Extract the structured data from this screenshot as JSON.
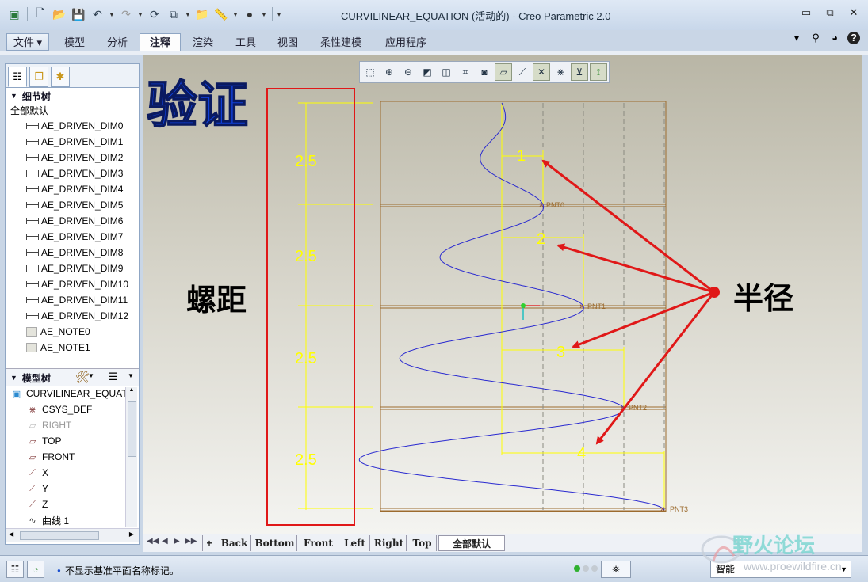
{
  "window": {
    "title": "CURVILINEAR_EQUATION (活动的) - Creo Parametric 2.0",
    "controls": {
      "minimize": "▭",
      "restore": "⧉",
      "close": "✕"
    }
  },
  "ribbon": {
    "tabs": [
      {
        "label": "文件 ▾"
      },
      {
        "label": "模型"
      },
      {
        "label": "分析"
      },
      {
        "label": "注释"
      },
      {
        "label": "渲染"
      },
      {
        "label": "工具"
      },
      {
        "label": "视图"
      },
      {
        "label": "柔性建模"
      },
      {
        "label": "应用程序"
      }
    ],
    "active_tab": "注释",
    "right_icons": [
      "▾",
      "⚲",
      "◕",
      "?"
    ]
  },
  "left_panel": {
    "detail_tree": {
      "title": "细节树",
      "filter": "全部默认",
      "items": [
        "AE_DRIVEN_DIM0",
        "AE_DRIVEN_DIM1",
        "AE_DRIVEN_DIM2",
        "AE_DRIVEN_DIM3",
        "AE_DRIVEN_DIM4",
        "AE_DRIVEN_DIM5",
        "AE_DRIVEN_DIM6",
        "AE_DRIVEN_DIM7",
        "AE_DRIVEN_DIM8",
        "AE_DRIVEN_DIM9",
        "AE_DRIVEN_DIM10",
        "AE_DRIVEN_DIM11",
        "AE_DRIVEN_DIM12",
        "AE_NOTE0",
        "AE_NOTE1"
      ]
    },
    "model_tree": {
      "title": "模型树",
      "root": "CURVILINEAR_EQUAT",
      "items": [
        {
          "label": "CSYS_DEF",
          "icon": "csys-icon"
        },
        {
          "label": "RIGHT",
          "icon": "datum-plane-icon",
          "dim": true
        },
        {
          "label": "TOP",
          "icon": "datum-plane-icon"
        },
        {
          "label": "FRONT",
          "icon": "datum-plane-icon"
        },
        {
          "label": "X",
          "icon": "axis-icon"
        },
        {
          "label": "Y",
          "icon": "axis-icon"
        },
        {
          "label": "Z",
          "icon": "axis-icon"
        },
        {
          "label": "曲线 1",
          "icon": "curve-icon"
        }
      ]
    }
  },
  "graphics": {
    "annotations": {
      "verify_title": "验证",
      "pitch_label": "螺距",
      "radius_label": "半径",
      "pitch_values": [
        "2.5",
        "2.5",
        "2.5",
        "2.5"
      ],
      "radius_indices": [
        "1",
        "2",
        "3",
        "4"
      ],
      "points": [
        "PNT0",
        "PNT1",
        "PNT2",
        "PNT3"
      ]
    },
    "colors": {
      "dimension": "#ffff00",
      "curve": "#2a2ad0",
      "arrow": "#e01818",
      "frame": "#9c6b2e",
      "title_blue": "#1040d8"
    }
  },
  "view_tabs": {
    "items": [
      "Back",
      "Bottom",
      "Front",
      "Left",
      "Right",
      "Top"
    ],
    "selected": "全部默认"
  },
  "status": {
    "message": "不显示基准平面名称标记。",
    "filter_value": "智能"
  },
  "watermark": {
    "title": "野火论坛",
    "url": "www.proewildfire.cn"
  }
}
